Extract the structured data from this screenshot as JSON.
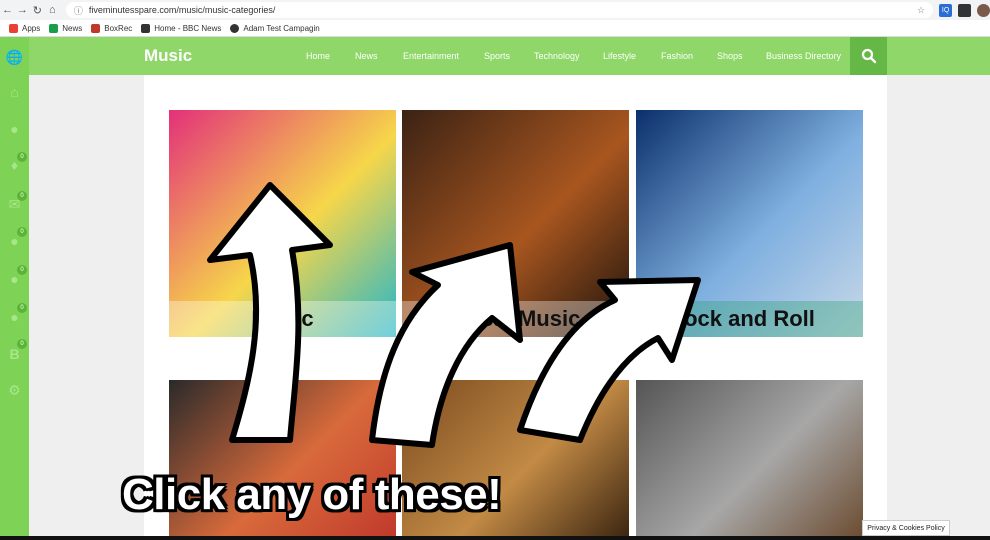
{
  "browser": {
    "url": "fiveminutesspare.com/music/music-categories/",
    "bookmarks": [
      {
        "label": "Apps",
        "color": "#e94235"
      },
      {
        "label": "News",
        "color": "#1a9e4b"
      },
      {
        "label": "BoxRec",
        "color": "#c0392b"
      },
      {
        "label": "Home - BBC News",
        "color": "#333333"
      },
      {
        "label": "Adam Test Campagin",
        "color": "#333333"
      }
    ],
    "extensions": [
      "IQ"
    ]
  },
  "site": {
    "title": "Music",
    "nav": [
      "Home",
      "News",
      "Entertainment",
      "Sports",
      "Technology",
      "Lifestyle",
      "Fashion",
      "Shops",
      "Business Directory"
    ],
    "rail_badges": [
      "0",
      "0",
      "0",
      "0",
      "0",
      "0"
    ],
    "colors": {
      "nav": "#8fd768",
      "rail": "#7ed357",
      "search": "#66b846"
    }
  },
  "categories": [
    {
      "caption": "Music",
      "palette": [
        "#e3307a",
        "#f6d64a",
        "#24b6c9"
      ]
    },
    {
      "caption": "ssical Music",
      "palette": [
        "#3b2214",
        "#a8561f",
        "#1a120c"
      ]
    },
    {
      "caption": "ock and Roll",
      "palette": [
        "#0b2f6b",
        "#7fb0e0",
        "#c9d9e8"
      ]
    },
    {
      "caption": "",
      "palette": [
        "#2a2a2a",
        "#d86a3b",
        "#c0392b"
      ]
    },
    {
      "caption": "",
      "palette": [
        "#7a4a1f",
        "#c28a45",
        "#3a2410"
      ]
    },
    {
      "caption": "",
      "palette": [
        "#555555",
        "#a7a7a7",
        "#6b4b2f"
      ]
    }
  ],
  "overlay": {
    "callout": "Click any of these!"
  },
  "footer": {
    "cookie_link": "Privacy & Cookies Policy"
  }
}
